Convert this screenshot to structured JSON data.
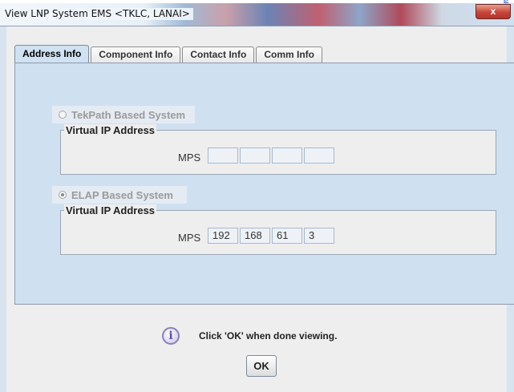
{
  "doc_overlay": {
    "blue_text": "g"
  },
  "window": {
    "title": "View LNP System EMS <TKLC, LANAI>",
    "close_label": "x"
  },
  "tabs": [
    {
      "label": "Address Info",
      "active": true
    },
    {
      "label": "Component Info",
      "active": false
    },
    {
      "label": "Contact Info",
      "active": false
    },
    {
      "label": "Comm Info",
      "active": false
    }
  ],
  "tekpath": {
    "label": "TekPath Based System",
    "selected": false,
    "legend": "Virtual IP Address",
    "field_label": "MPS",
    "octets": [
      "",
      "",
      "",
      ""
    ]
  },
  "elap": {
    "label": "ELAP Based System",
    "selected": true,
    "legend": "Virtual IP Address",
    "field_label": "MPS",
    "octets": [
      "192",
      "168",
      "61",
      "3"
    ]
  },
  "message": {
    "icon": "info-icon",
    "text": "Click 'OK' when done viewing."
  },
  "ok_button": {
    "label": "OK"
  }
}
